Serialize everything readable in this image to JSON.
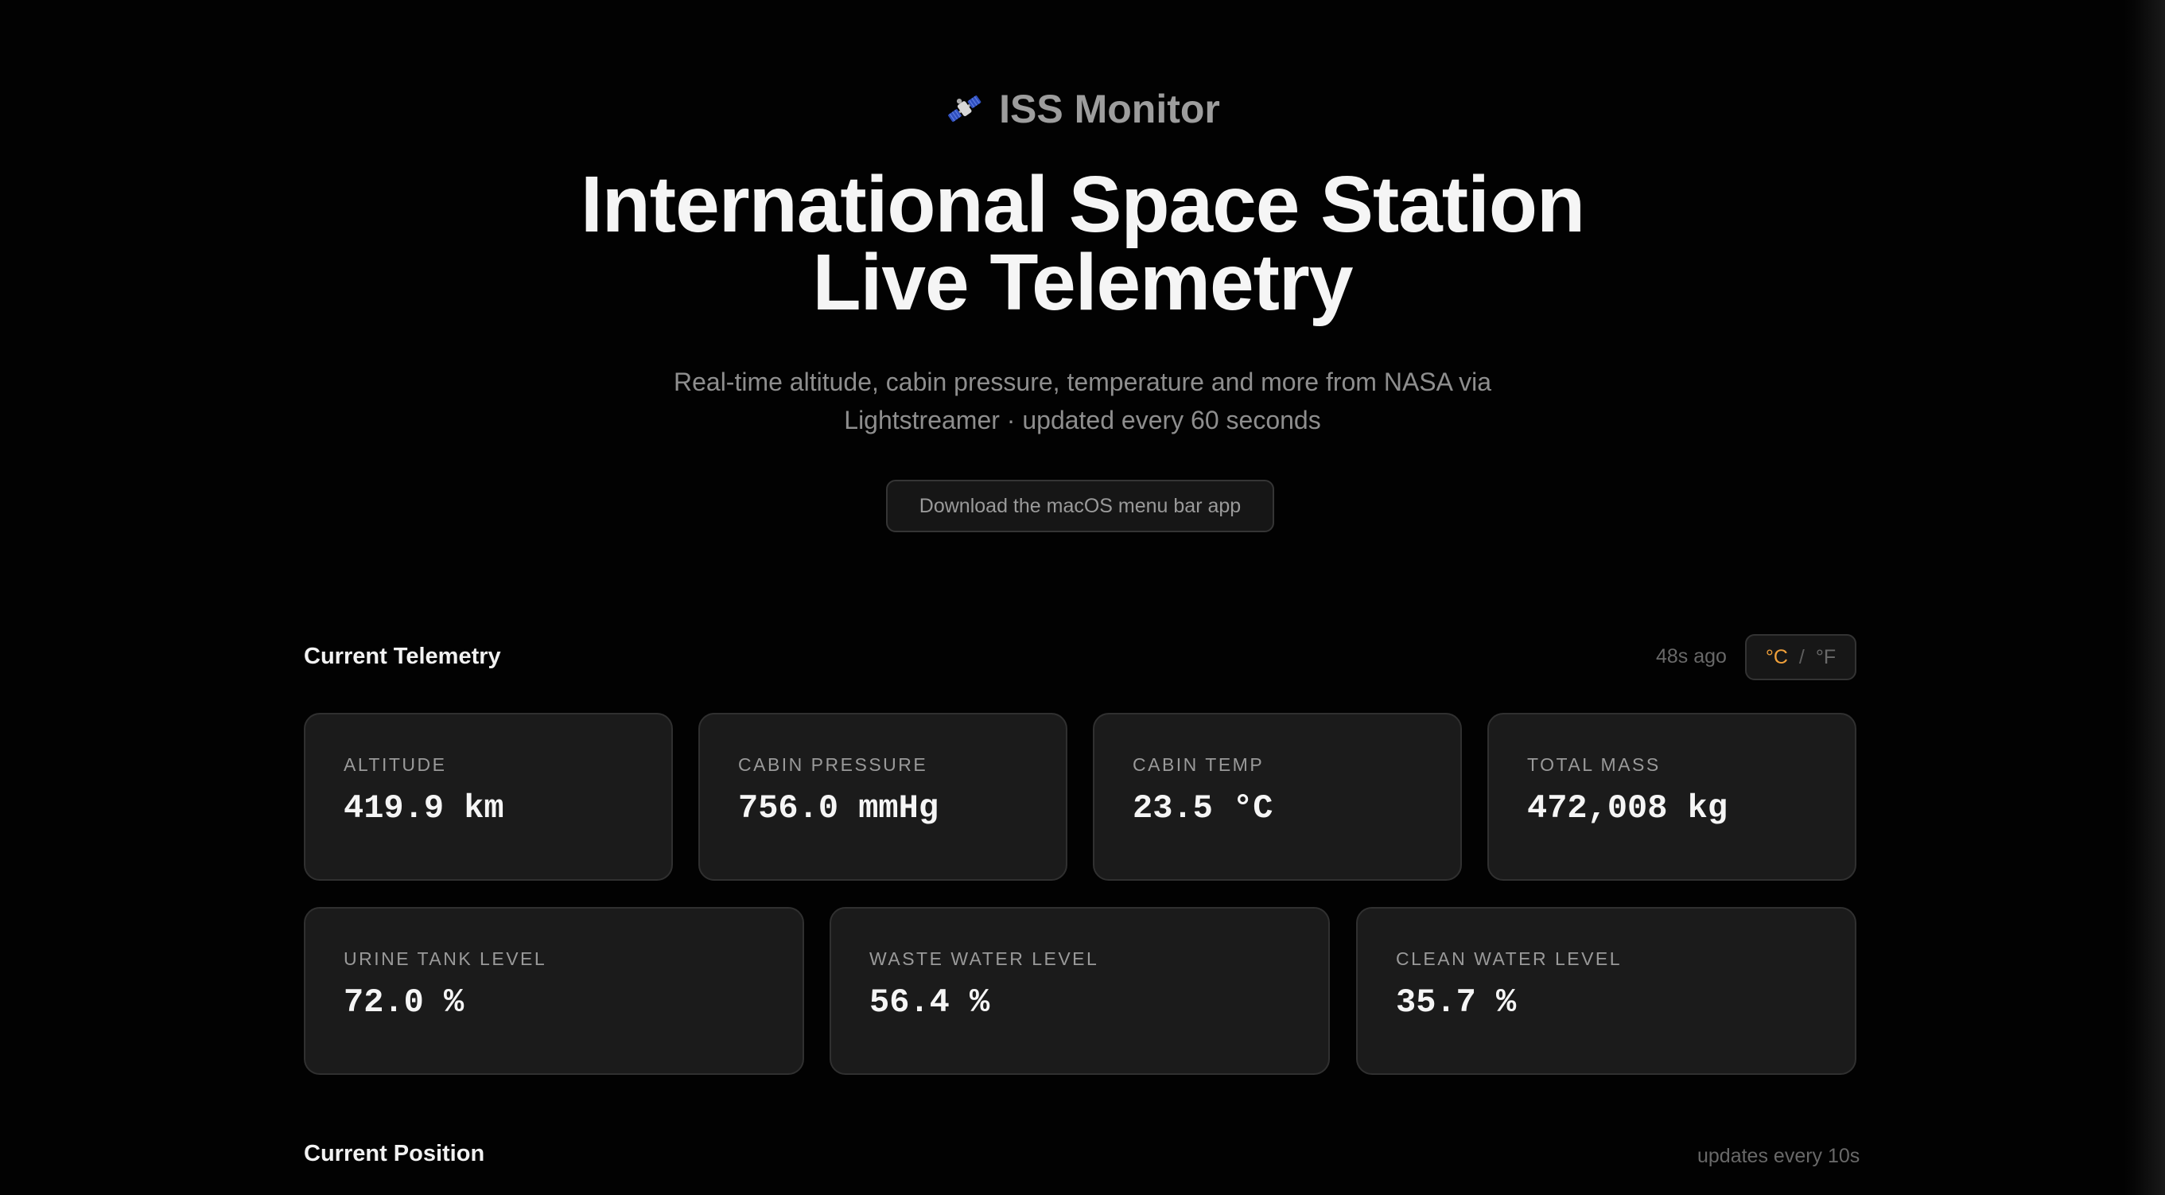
{
  "brand": {
    "icon": "satellite-icon",
    "name": "ISS Monitor"
  },
  "hero": {
    "title_line1": "International Space Station",
    "title_line2": "Live Telemetry",
    "subtitle_line1": "Real-time altitude, cabin pressure, temperature and more from NASA via",
    "subtitle_line2": "Lightstreamer · updated every 60 seconds",
    "download_label": "Download the macOS menu bar app"
  },
  "telemetry": {
    "title": "Current Telemetry",
    "updated": "48s ago",
    "unit_celsius": "°C",
    "unit_separator": "/",
    "unit_fahrenheit": "°F",
    "selected_unit": "°C",
    "accent_color": "#f0a03a",
    "cards": [
      {
        "label": "ALTITUDE",
        "value": "419.9 km"
      },
      {
        "label": "CABIN PRESSURE",
        "value": "756.0 mmHg"
      },
      {
        "label": "CABIN TEMP",
        "value": "23.5 °C"
      },
      {
        "label": "TOTAL MASS",
        "value": "472,008 kg"
      },
      {
        "label": "URINE TANK LEVEL",
        "value": "72.0 %"
      },
      {
        "label": "WASTE WATER LEVEL",
        "value": "56.4 %"
      },
      {
        "label": "CLEAN WATER LEVEL",
        "value": "35.7 %"
      }
    ]
  },
  "position": {
    "title": "Current Position",
    "update_note": "updates every 10s"
  }
}
